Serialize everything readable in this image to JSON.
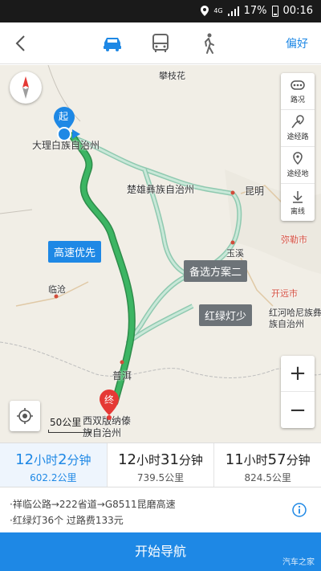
{
  "status_bar": {
    "network": "4G",
    "battery": "17%",
    "time": "00:16"
  },
  "nav": {
    "preference": "偏好"
  },
  "map": {
    "places": {
      "panzhihua": "攀枝花",
      "dali": "大理白族自治州",
      "chuxiong": "楚雄彝族自治州",
      "kunming": "昆明",
      "yuxi": "玉溪",
      "mile": "弥勒市",
      "lincang": "临沧",
      "kaiyuan": "开远市",
      "honghe": "红河哈尼族彝族自治州",
      "puer": "普洱",
      "xishuangbanna": "西双版纳傣族自治州"
    },
    "start_marker": "起",
    "end_marker": "终",
    "route_tags": {
      "highway": "高速优先",
      "alt2": "备选方案二",
      "fewer_lights": "红绿灯少"
    },
    "scale": "50公里",
    "tools": {
      "traffic": "路况",
      "via_road": "途经路",
      "via_place": "途经地",
      "offline": "离线"
    },
    "zoom_in": "+",
    "zoom_out": "−"
  },
  "routes": [
    {
      "hours": "12",
      "h_unit": "小时",
      "minutes": "2",
      "m_unit": "分钟",
      "distance": "602.2公里",
      "selected": true
    },
    {
      "hours": "12",
      "h_unit": "小时",
      "minutes": "31",
      "m_unit": "分钟",
      "distance": "739.5公里",
      "selected": false
    },
    {
      "hours": "11",
      "h_unit": "小时",
      "minutes": "57",
      "m_unit": "分钟",
      "distance": "824.5公里",
      "selected": false
    }
  ],
  "detail": {
    "roads": "·祥临公路→222省道→G8511昆磨高速",
    "lights_fee": "·红绿灯36个  过路费133元"
  },
  "start_navigation": "开始导航",
  "watermark": "汽车之家",
  "colors": {
    "accent": "#1e88e5",
    "route_main": "#3cb563",
    "route_alt": "#a8d5c0",
    "red_marker": "#e53935"
  }
}
